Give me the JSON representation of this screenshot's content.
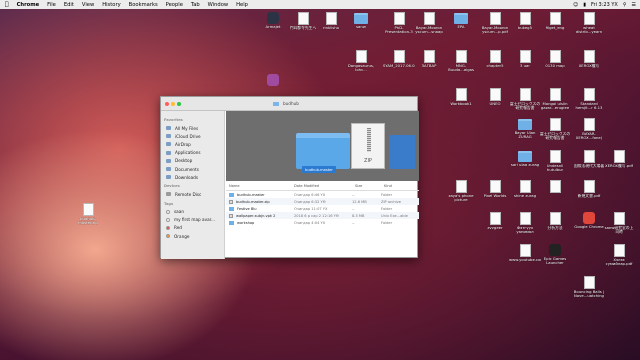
{
  "menubar": {
    "apple": "",
    "items": [
      "Chrome",
      "File",
      "Edit",
      "View",
      "History",
      "Bookmarks",
      "People",
      "Tab",
      "Window",
      "Help"
    ],
    "clock": "Fri 3:23 ҮХ"
  },
  "desktop_icons": [
    {
      "label": "Armajet",
      "type": "app",
      "color": "#2b3344"
    },
    {
      "label": "門耳都令先生へ",
      "type": "doc"
    },
    {
      "label": "rinkiisho",
      "type": "doc"
    },
    {
      "label": "sanw",
      "type": "folder"
    },
    {
      "label": "PhD-Presentation-3",
      "type": "doc"
    },
    {
      "label": "Bayar-Mooron yscum...snaap",
      "type": "doc"
    },
    {
      "label": "EPA",
      "type": "folder"
    },
    {
      "label": "Bayar-Mooron yscum...p.pdf",
      "type": "doc"
    },
    {
      "label": "bukeg5",
      "type": "doc"
    },
    {
      "label": "filget_eng",
      "type": "doc"
    },
    {
      "label": "wheat distrib...yearn",
      "type": "doc"
    },
    {
      "label": "Dangasaurus, Iohc...",
      "type": "doc"
    },
    {
      "label": "SYAM_2017.06.05_[17...R0856]",
      "type": "doc"
    },
    {
      "label": "ЗАГВАР",
      "type": "doc"
    },
    {
      "label": "MNG-Buuda...aigas",
      "type": "doc"
    },
    {
      "label": "chapter5",
      "type": "doc"
    },
    {
      "label": "3 uar",
      "type": "doc"
    },
    {
      "label": "0130 map",
      "type": "doc"
    },
    {
      "label": "XEROX複写",
      "type": "doc"
    },
    {
      "label": "",
      "type": "app",
      "color": "#a04aa0"
    },
    {
      "label": "Workbook1",
      "type": "doc"
    },
    {
      "label": "UNEO",
      "type": "doc"
    },
    {
      "label": "富士ゼロックスの研究報告書",
      "type": "doc"
    },
    {
      "label": "Mongol ulsiin gazar...erugiee",
      "type": "doc"
    },
    {
      "label": "Standard hemjit...r 6.13",
      "type": "doc"
    },
    {
      "label": "Bayar Ulan ZURAG",
      "type": "folder"
    },
    {
      "label": "富士ゼロックスの研究報告書",
      "type": "doc"
    },
    {
      "label": "BAYAR-XEROX...fone)",
      "type": "doc"
    },
    {
      "label": "sari ulaa zurag",
      "type": "folder"
    },
    {
      "label": "Undesnii hutulbur",
      "type": "doc"
    },
    {
      "label": "国際法現代大場著",
      "type": "doc"
    },
    {
      "label": "XEROX複写.pdf",
      "type": "doc"
    },
    {
      "label": "zaya's phone picture",
      "type": "doc"
    },
    {
      "label": "Pixel Worlds",
      "type": "doc"
    },
    {
      "label": "shine zurag",
      "type": "doc"
    },
    {
      "label": "",
      "type": "doc"
    },
    {
      "label": "新規文書.pdf",
      "type": "doc"
    },
    {
      "label": "zvvgeer",
      "type": "doc"
    },
    {
      "label": "Фэтгүүх уанимал",
      "type": "doc"
    },
    {
      "label": "分析方法",
      "type": "doc"
    },
    {
      "label": "Google Chrome",
      "type": "app",
      "color": "#e0463a"
    },
    {
      "label": "sanw研究室の上司時",
      "type": "doc"
    },
    {
      "label": "www.youtube.com",
      "type": "doc"
    },
    {
      "label": "Epic Games Launcher",
      "type": "app",
      "color": "#222"
    },
    {
      "label": "Bouncing Balls | Nove...uatching",
      "type": "doc"
    },
    {
      "label": "Хэлээ сумийлар.pdf",
      "type": "doc"
    }
  ],
  "desktop_left_file": "budhub-master.zip",
  "finder": {
    "title": "budhub",
    "sidebar_fav_header": "Favorites",
    "sidebar_favs": [
      "All My Files",
      "iCloud Drive",
      "AirDrop",
      "Applications",
      "Desktop",
      "Documents",
      "Downloads"
    ],
    "sidebar_dev_header": "Devices",
    "sidebar_devs": [
      "Remote Disc"
    ],
    "sidebar_tags_header": "Tags",
    "sidebar_tags": [
      {
        "label": "saan",
        "color": "#ffffff"
      },
      {
        "label": "my first map avar...",
        "color": "#ffffff"
      },
      {
        "label": "Red",
        "color": "#fc4a4a"
      },
      {
        "label": "Orange",
        "color": "#fd9a2a"
      }
    ],
    "preview_folder_label": "budhub-master",
    "preview_zip_label": "ZIP",
    "columns": [
      "Name",
      "Date Modified",
      "Size",
      "Kind"
    ],
    "rows": [
      {
        "name": "budhub-master",
        "date": "Ӧчигдар 6:46 ҮХ",
        "size": "--",
        "kind": "Folder",
        "type": "folder"
      },
      {
        "name": "budhub-master.zip",
        "date": "Ӧчигдар 6:32 ҮӨ",
        "size": "12.6 MB",
        "kind": "ZIP archive",
        "type": "zip"
      },
      {
        "name": "Festive Blu",
        "date": "Ӧчигдар 11:07 ҮХ",
        "size": "--",
        "kind": "Folder",
        "type": "folder"
      },
      {
        "name": "wallpaper-subjn.vpk 2",
        "date": "2018 6 p сар 2 12:16 ҮӨ",
        "size": "8.3 MB",
        "kind": "Unix Exe...able",
        "type": "zip"
      },
      {
        "name": "workshop",
        "date": "Ӧчигдар 4:04 ҮХ",
        "size": "--",
        "kind": "Folder",
        "type": "folder"
      }
    ]
  }
}
